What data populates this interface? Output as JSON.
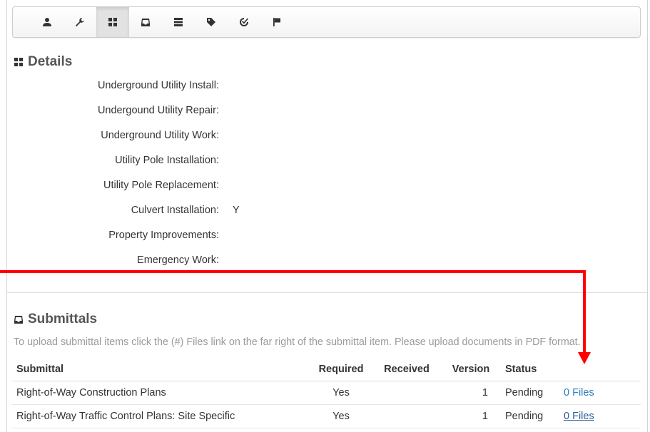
{
  "toolbar": {
    "icons": [
      "user-icon",
      "wrench-icon",
      "grid-icon",
      "inbox-icon",
      "list-icon",
      "tag-icon",
      "check-icon",
      "flag-icon"
    ],
    "active_index": 2
  },
  "details": {
    "title": "Details",
    "rows": [
      {
        "label": "Underground Utility Install:",
        "value": ""
      },
      {
        "label": "Undergound Utility Repair:",
        "value": ""
      },
      {
        "label": "Underground Utility Work:",
        "value": ""
      },
      {
        "label": "Utility Pole Installation:",
        "value": ""
      },
      {
        "label": "Utility Pole Replacement:",
        "value": ""
      },
      {
        "label": "Culvert Installation:",
        "value": "Y"
      },
      {
        "label": "Property Improvements:",
        "value": ""
      },
      {
        "label": "Emergency Work:",
        "value": ""
      }
    ]
  },
  "submittals": {
    "title": "Submittals",
    "hint": "To upload submittal items click the (#) Files link on the far right of the submittal item. Please upload documents in PDF format.",
    "headers": {
      "submittal": "Submittal",
      "required": "Required",
      "received": "Received",
      "version": "Version",
      "status": "Status"
    },
    "rows": [
      {
        "submittal": "Right-of-Way Construction Plans",
        "required": "Yes",
        "received": "",
        "version": "1",
        "status": "Pending",
        "files": "0 Files"
      },
      {
        "submittal": "Right-of-Way Traffic Control Plans: Site Specific",
        "required": "Yes",
        "received": "",
        "version": "1",
        "status": "Pending",
        "files": "0 Files"
      }
    ]
  },
  "annotation": {
    "color": "#ff0000"
  }
}
